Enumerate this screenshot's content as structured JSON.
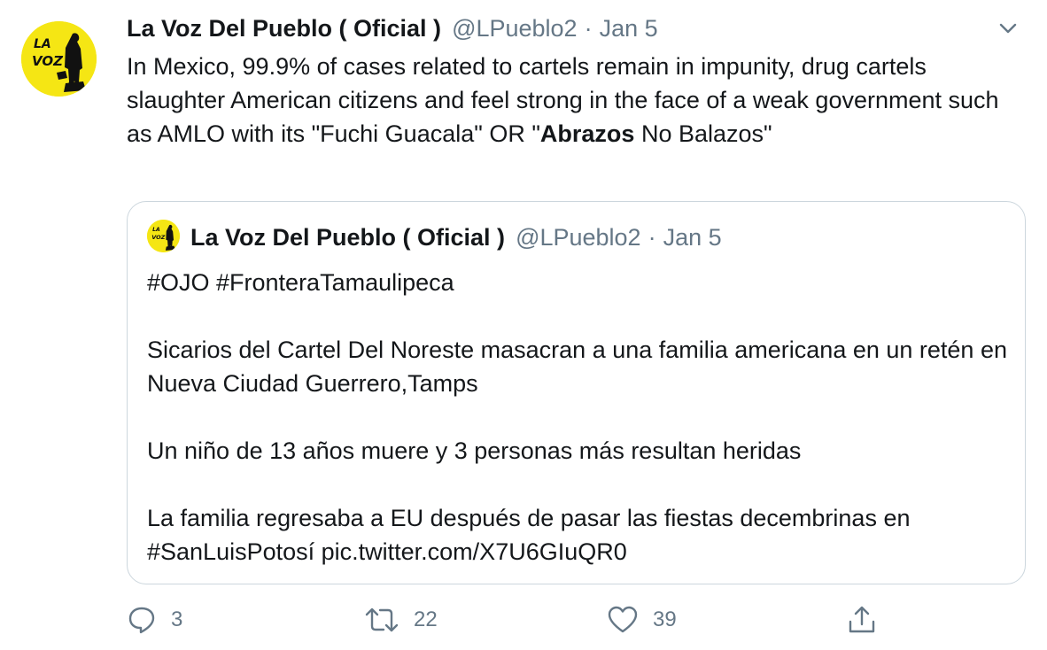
{
  "tweet": {
    "author_name": "La Voz Del Pueblo ( Oficial )",
    "handle": "@LPueblo2",
    "separator": "·",
    "date": "Jan 5",
    "text_before_bold": "In Mexico, 99.9% of cases related to cartels remain in impunity, drug cartels slaughter American citizens and feel strong in the face of a weak government such as AMLO with its \"Fuchi Guacala\" OR \"",
    "text_bold": "Abrazos",
    "text_after_bold": " No Balazos\"",
    "avatar_text": "LA VOZ",
    "caret_icon": "chevron-down-icon"
  },
  "quote": {
    "author_name": "La Voz Del Pueblo ( Oficial )",
    "handle": "@LPueblo2",
    "separator": "·",
    "date": "Jan 5",
    "avatar_text": "LA VOZ",
    "paragraphs": [
      "#OJO #FronteraTamaulipeca",
      "Sicarios del Cartel Del Noreste masacran a una familia americana en un retén en Nueva Ciudad Guerrero,Tamps",
      "Un niño de 13 años muere y 3 personas más resultan heridas",
      "La familia regresaba a EU después de pasar las fiestas decembrinas en #SanLuisPotosí pic.twitter.com/X7U6GIuQR0"
    ]
  },
  "actions": {
    "reply": {
      "icon": "reply-icon",
      "count": "3"
    },
    "retweet": {
      "icon": "retweet-icon",
      "count": "22"
    },
    "like": {
      "icon": "heart-icon",
      "count": "39"
    },
    "share": {
      "icon": "share-icon"
    }
  },
  "colors": {
    "text": "#14171a",
    "secondary": "#657786",
    "border": "#ccd6dd",
    "avatar_bg": "#f5e614"
  }
}
